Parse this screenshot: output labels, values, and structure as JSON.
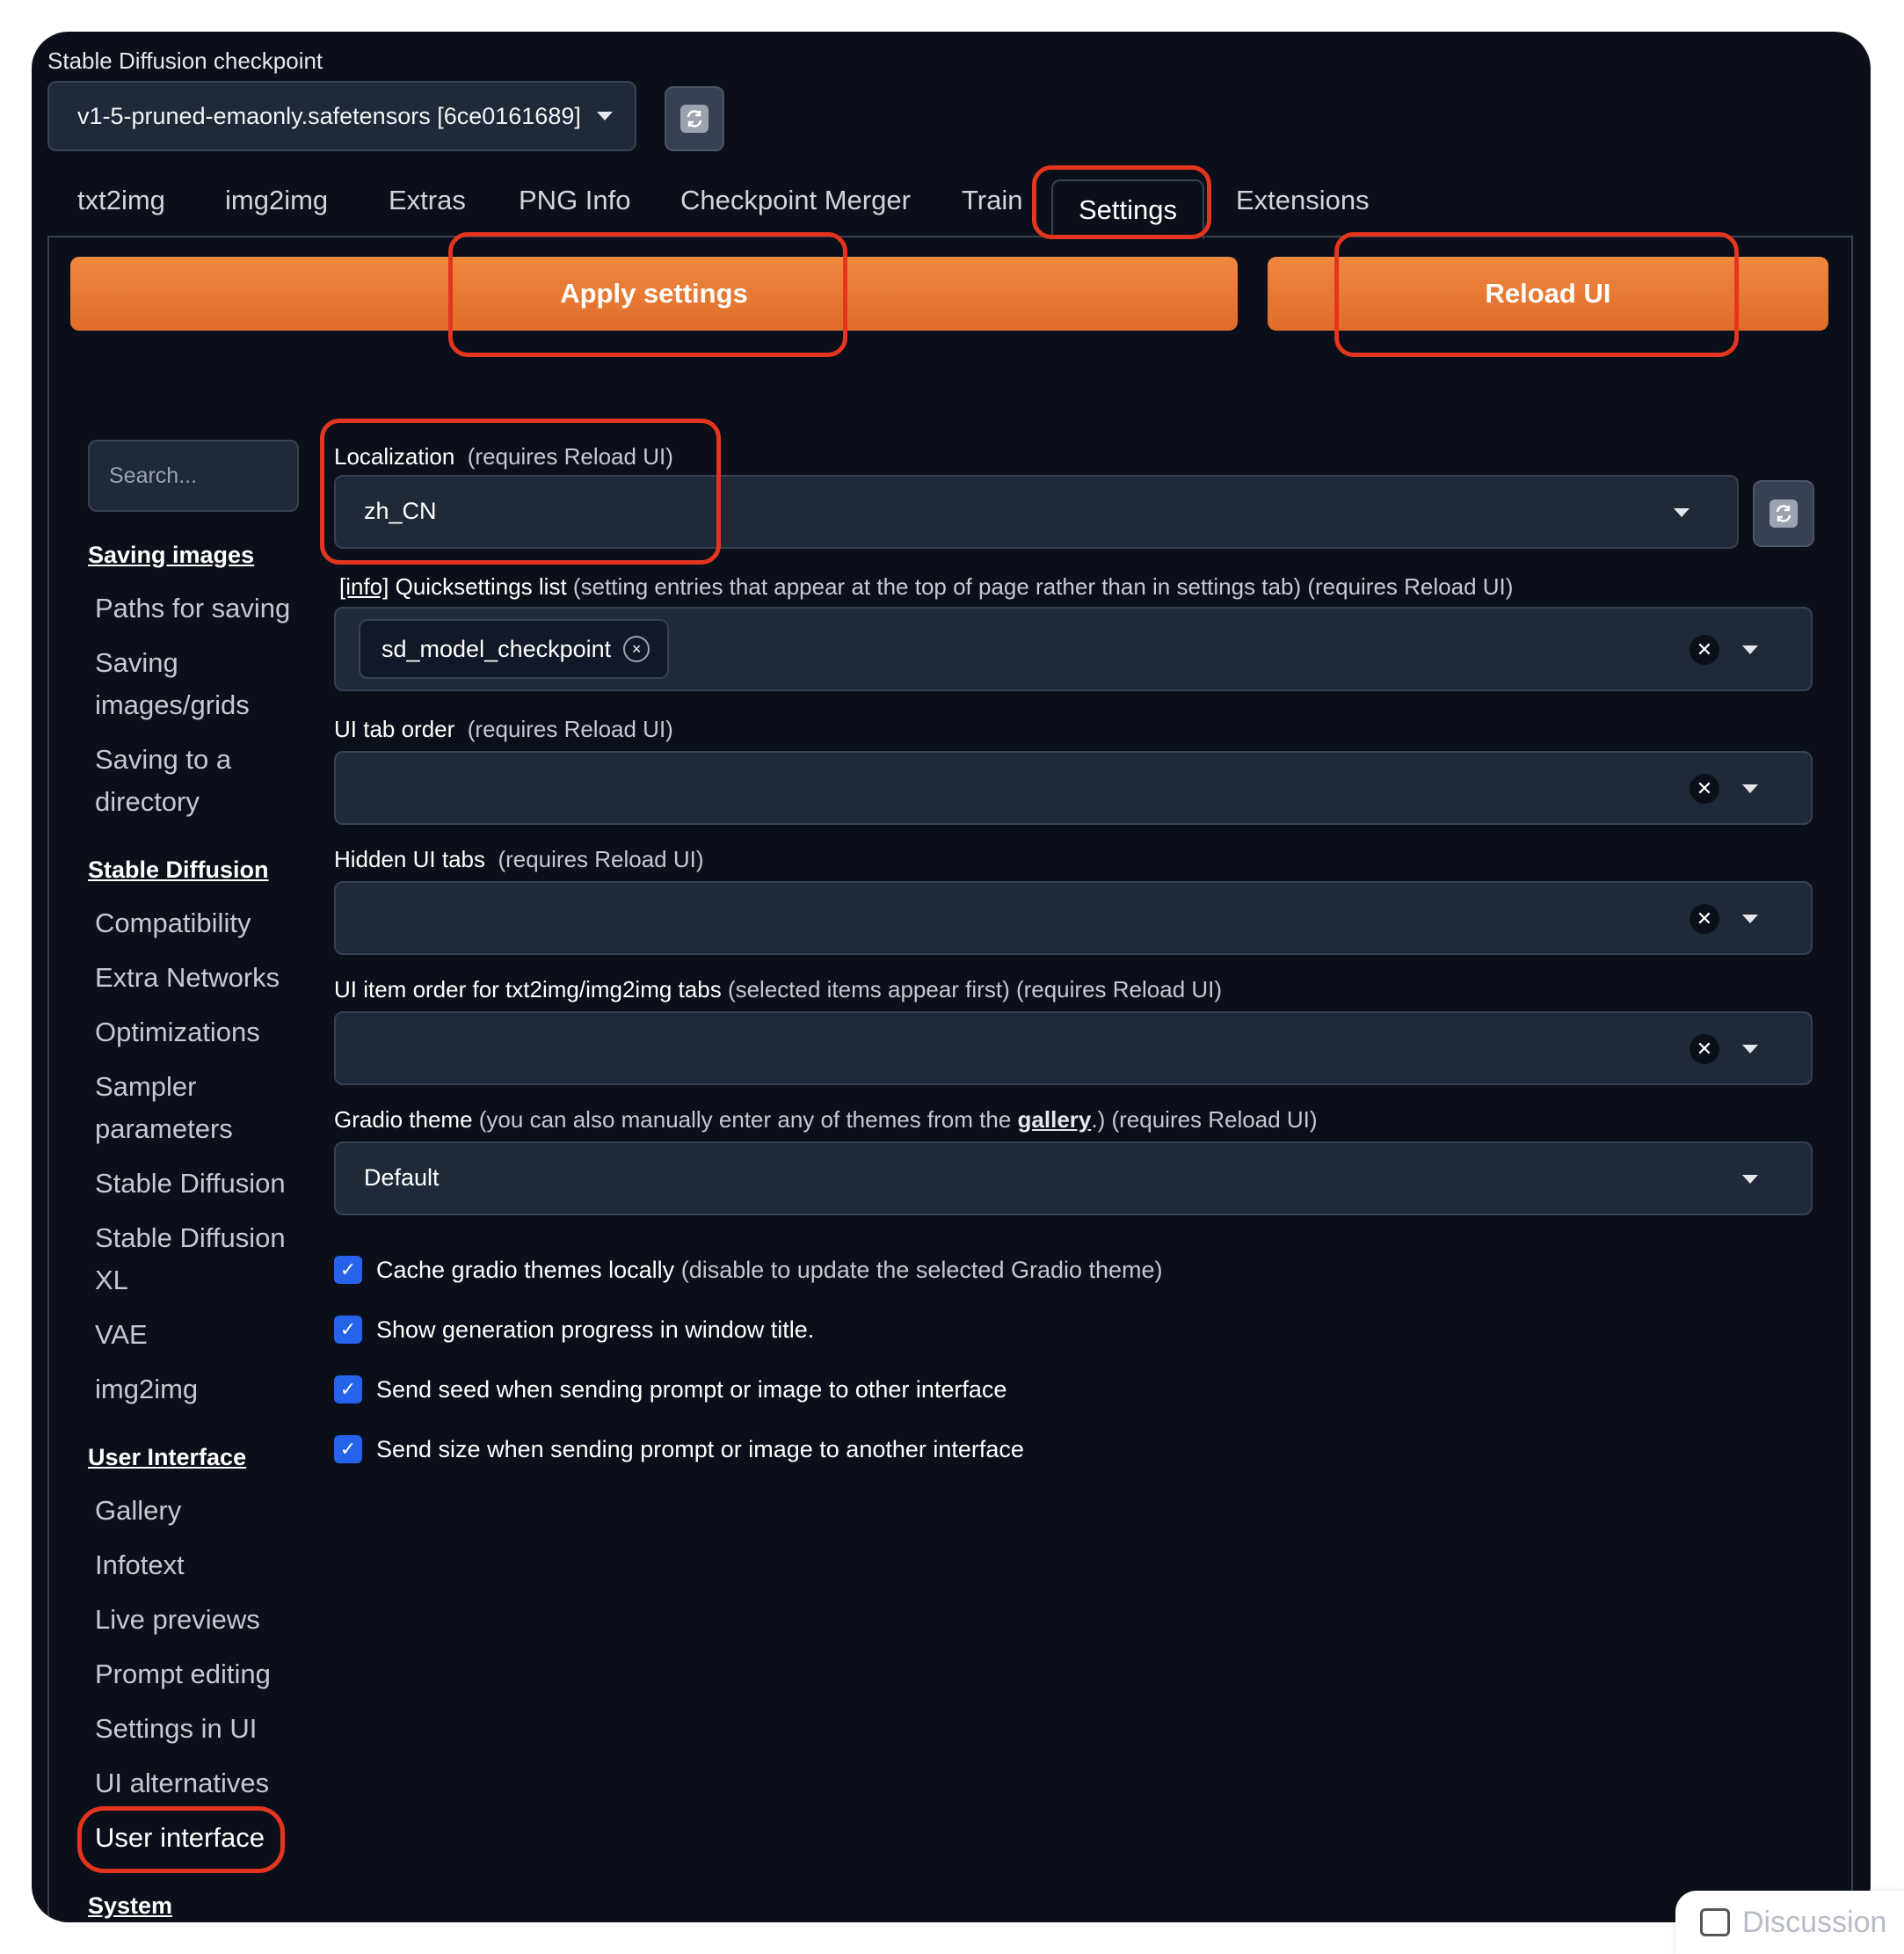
{
  "checkpoint": {
    "label": "Stable Diffusion checkpoint",
    "selected": "v1-5-pruned-emaonly.safetensors [6ce0161689]"
  },
  "tabs": [
    "txt2img",
    "img2img",
    "Extras",
    "PNG Info",
    "Checkpoint Merger",
    "Train",
    "Settings",
    "Extensions"
  ],
  "active_tab": "Settings",
  "buttons": {
    "apply": "Apply settings",
    "reload": "Reload UI"
  },
  "search": {
    "placeholder": "Search..."
  },
  "sidebar": {
    "sections": [
      {
        "title": "Saving images",
        "items": [
          "Paths for saving",
          "Saving images/grids",
          "Saving to a directory"
        ]
      },
      {
        "title": "Stable Diffusion",
        "items": [
          "Compatibility",
          "Extra Networks",
          "Optimizations",
          "Sampler parameters",
          "Stable Diffusion",
          "Stable Diffusion XL",
          "VAE",
          "img2img"
        ]
      },
      {
        "title": "User Interface",
        "items": [
          "Gallery",
          "Infotext",
          "Live previews",
          "Prompt editing",
          "Settings in UI",
          "UI alternatives",
          "User interface"
        ]
      },
      {
        "title": "System"
      }
    ],
    "active_item": "User interface"
  },
  "settings": {
    "localization": {
      "label": "Localization",
      "note": "(requires Reload UI)",
      "value": "zh_CN"
    },
    "quicksettings": {
      "info": "[info]",
      "label": "Quicksettings list",
      "note": "(setting entries that appear at the top of page rather than in settings tab) (requires Reload UI)",
      "chip": "sd_model_checkpoint"
    },
    "tab_order": {
      "label": "UI tab order",
      "note": "(requires Reload UI)"
    },
    "hidden_tabs": {
      "label": "Hidden UI tabs",
      "note": "(requires Reload UI)"
    },
    "item_order": {
      "label": "UI item order for txt2img/img2img tabs",
      "note": "(selected items appear first) (requires Reload UI)"
    },
    "gradio_theme": {
      "label": "Gradio theme",
      "note_before": "(you can also manually enter any of themes from the",
      "link": "gallery",
      "note_after": ".) (requires Reload UI)",
      "value": "Default"
    },
    "checkboxes": [
      {
        "label": "Cache gradio themes locally",
        "note": "(disable to update the selected Gradio theme)",
        "checked": true
      },
      {
        "label": "Show generation progress in window title.",
        "note": "",
        "checked": true
      },
      {
        "label": "Send seed when sending prompt or image to other interface",
        "note": "",
        "checked": true
      },
      {
        "label": "Send size when sending prompt or image to another interface",
        "note": "",
        "checked": true
      }
    ]
  },
  "discussion_label": "Discussion",
  "colors": {
    "background": "#0b0f19",
    "accent": "#e8742f",
    "highlight": "#e3351f",
    "checkbox": "#2563eb"
  }
}
